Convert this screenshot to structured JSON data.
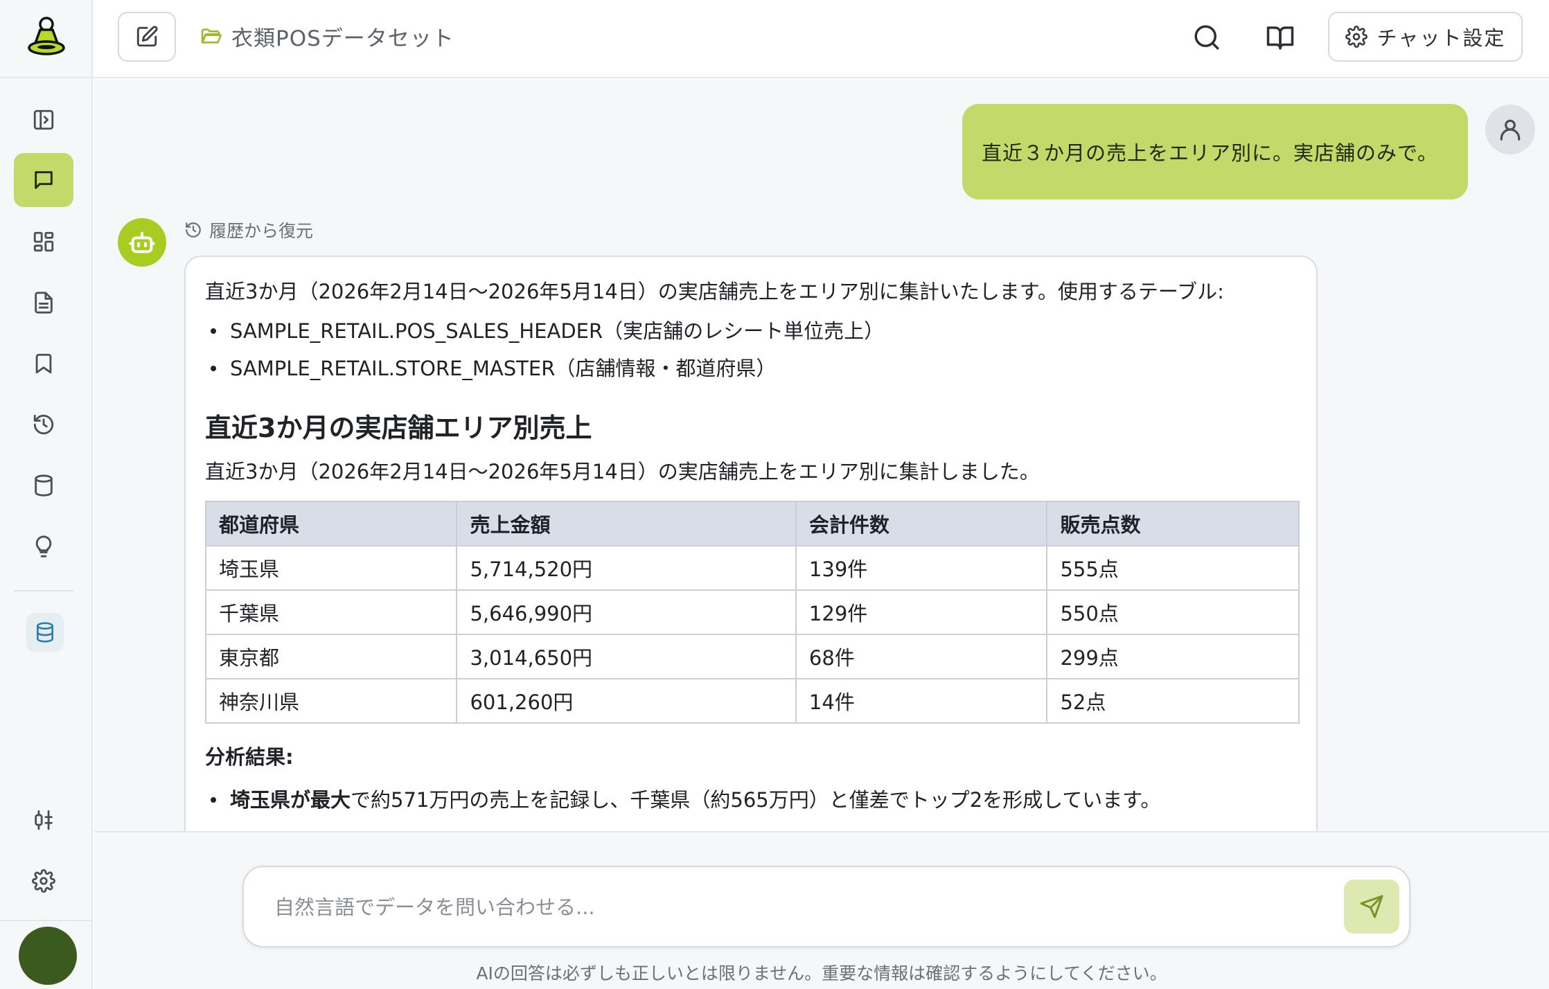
{
  "header": {
    "dataset_name": "衣類POSデータセット",
    "settings_label": "チャット設定"
  },
  "chat": {
    "user_message": "直近３か月の売上をエリア別に。実店舗のみで。",
    "restore_label": "履歴から復元",
    "response": {
      "intro": "直近3か月（2026年2月14日〜2026年5月14日）の実店舗売上をエリア別に集計いたします。使用するテーブル:",
      "tables_used": [
        "SAMPLE_RETAIL.POS_SALES_HEADER（実店舗のレシート単位売上）",
        "SAMPLE_RETAIL.STORE_MASTER（店舗情報・都道府県）"
      ],
      "heading": "直近3か月の実店舗エリア別売上",
      "summary": "直近3か月（2026年2月14日〜2026年5月14日）の実店舗売上をエリア別に集計しました。",
      "table": {
        "headers": [
          "都道府県",
          "売上金額",
          "会計件数",
          "販売点数"
        ],
        "rows": [
          [
            "埼玉県",
            "5,714,520円",
            "139件",
            "555点"
          ],
          [
            "千葉県",
            "5,646,990円",
            "129件",
            "550点"
          ],
          [
            "東京都",
            "3,014,650円",
            "68件",
            "299点"
          ],
          [
            "神奈川県",
            "601,260円",
            "14件",
            "52点"
          ]
        ]
      },
      "analysis_heading": "分析結果:",
      "analysis_first_bold": "埼玉県が最大",
      "analysis_first_rest": "で約571万円の売上を記録し、千葉県（約565万円）と僅差でトップ2を形成しています。"
    }
  },
  "composer": {
    "placeholder": "自然言語でデータを問い合わせる...",
    "disclaimer": "AIの回答は必ずしも正しいとは限りません。重要な情報は確認するようにしてください。"
  },
  "icons": {
    "logo": "ufo-logo-icon",
    "sidebar": [
      "panel-toggle-icon",
      "chat-icon",
      "dashboard-icon",
      "document-icon",
      "bookmark-icon",
      "history-icon",
      "database-icon",
      "lightbulb-icon",
      "database-icon",
      "connection-icon",
      "settings-gear-icon"
    ]
  },
  "colors": {
    "accent": "#c3d96a",
    "bot_avatar": "#a8cc1f",
    "table_header_bg": "#d8dde8"
  }
}
